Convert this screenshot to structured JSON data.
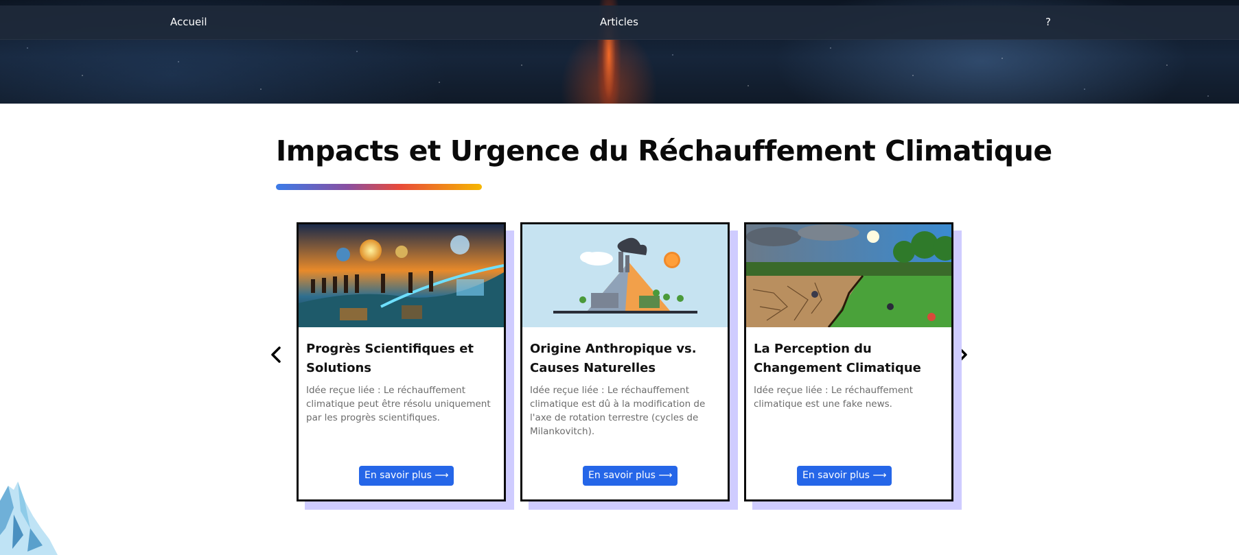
{
  "nav": {
    "home": "Accueil",
    "articles": "Articles",
    "help": "?"
  },
  "section": {
    "title": "Impacts et Urgence du Réchauffement Climatique"
  },
  "carousel": {
    "prev_icon": "chevron-left-icon",
    "next_icon": "chevron-right-icon",
    "cards": [
      {
        "title": "Progrès Scientifiques et Solutions",
        "description": "Idée reçue liée : Le réchauffement climatique peut être résolu uniquement par les progrès scientifiques.",
        "button": "En savoir plus ⟶",
        "image_alt": "Frise de l'évolution humaine et des avancées scientifiques"
      },
      {
        "title": "Origine Anthropique vs. Causes Naturelles",
        "description": "Idée reçue liée : Le réchauffement climatique est dû à la modification de l'axe de rotation terrestre (cycles de Milankovitch).",
        "button": "En savoir plus ⟶",
        "image_alt": "Usine polluante et volcan sous le soleil"
      },
      {
        "title": "La Perception du Changement Climatique",
        "description": "Idée reçue liée : Le réchauffement climatique est une fake news.",
        "button": "En savoir plus ⟶",
        "image_alt": "Terre desséchée face à une prairie verdoyante"
      }
    ]
  },
  "colors": {
    "accent": "#2566e8",
    "card_shadow": "#cfccff",
    "navbar": "#1e2939"
  }
}
